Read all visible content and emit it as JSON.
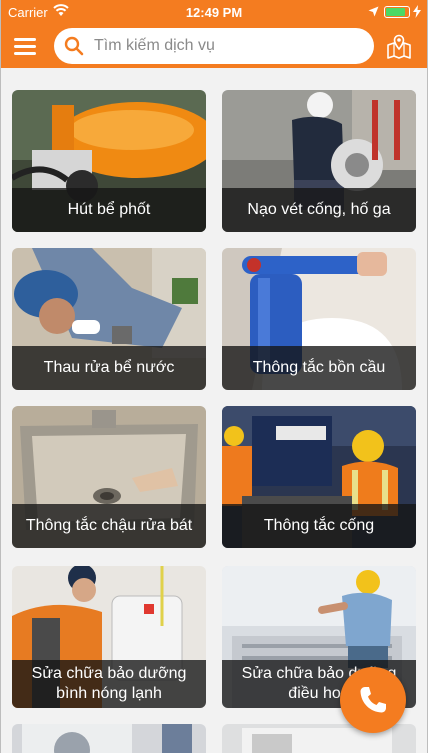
{
  "status_bar": {
    "carrier": "Carrier",
    "time": "12:49 PM",
    "battery_level": 0.9,
    "battery_color": "#4cd964"
  },
  "header": {
    "background_color": "#f47c20",
    "menu_icon": "hamburger-menu-icon",
    "search": {
      "placeholder": "Tìm kiếm dịch vụ",
      "value": "",
      "icon": "search-icon"
    },
    "map_icon": "map-pin-icon"
  },
  "services": [
    {
      "label": "Hút bể phốt",
      "image": "orange-vacuum-truck-photo"
    },
    {
      "label": "Nạo vét cống, hố ga",
      "image": "worker-with-drain-machine-photo"
    },
    {
      "label": "Thau rửa bể nước",
      "image": "worker-cleaning-water-tank-photo"
    },
    {
      "label": "Thông tắc bồn cầu",
      "image": "blue-toilet-plunger-photo"
    },
    {
      "label": "Thông tắc chậu rửa bát",
      "image": "stainless-sink-drain-photo"
    },
    {
      "label": "Thông tắc cống",
      "image": "workers-in-hard-hats-photo"
    },
    {
      "label": "Sửa chữa bảo dưỡng\nbình nóng lạnh",
      "image": "water-heater-repair-photo"
    },
    {
      "label": "Sửa chữa bảo dưỡng\nđiều hoà",
      "image": "air-conditioner-repair-photo"
    },
    {
      "label": "",
      "image": "washing-machine-photo"
    },
    {
      "label": "",
      "image": "appliance-photo"
    }
  ],
  "call_button": {
    "icon": "phone-icon",
    "color": "#f47c20"
  }
}
